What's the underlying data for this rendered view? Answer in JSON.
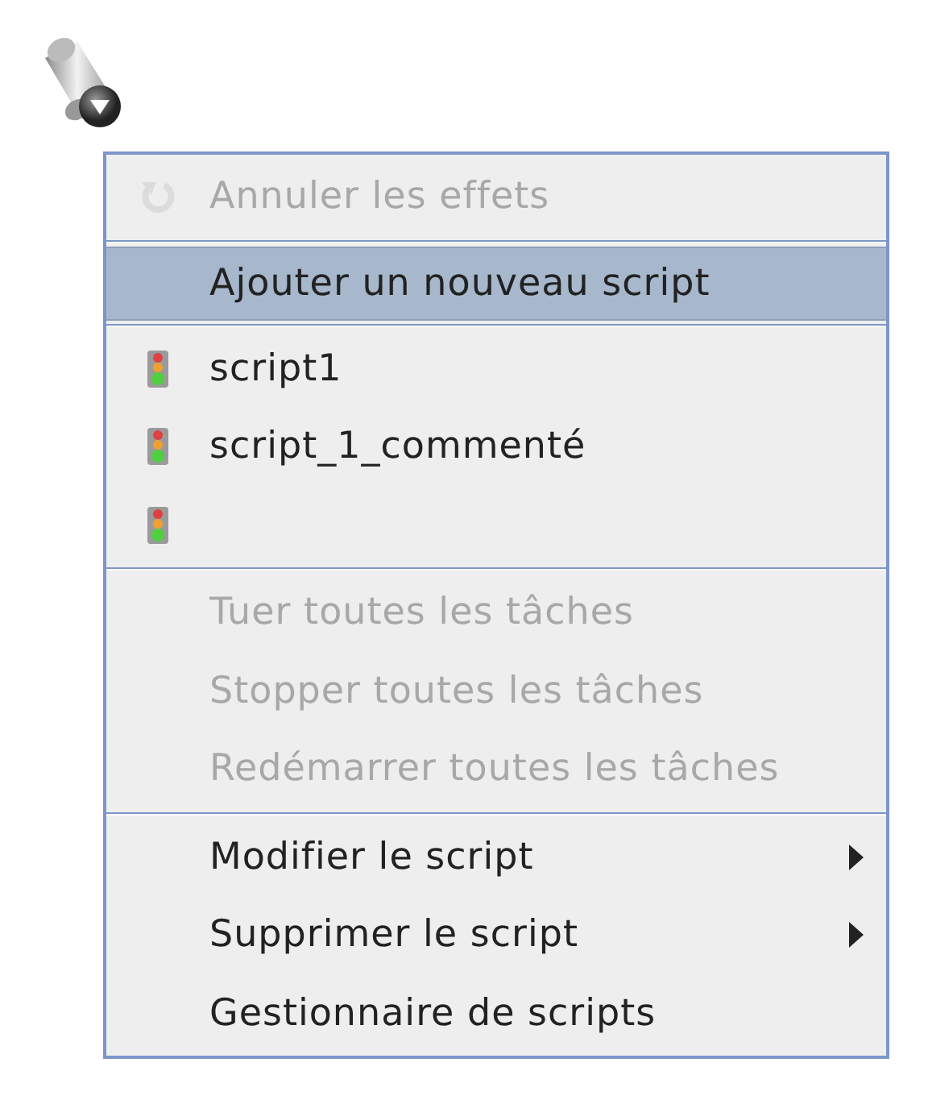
{
  "menu": {
    "sections": [
      {
        "items": [
          {
            "label": "Annuler les effets",
            "kind": "undo",
            "disabled": true,
            "selected": false,
            "submenu": false
          }
        ]
      },
      {
        "items": [
          {
            "label": "Ajouter un nouveau script",
            "kind": "plain",
            "disabled": false,
            "selected": true,
            "submenu": false
          }
        ]
      },
      {
        "items": [
          {
            "label": "script1",
            "kind": "script",
            "disabled": false,
            "selected": false,
            "submenu": false
          },
          {
            "label": "script_1_commenté",
            "kind": "script",
            "disabled": false,
            "selected": false,
            "submenu": false
          },
          {
            "kind": "script",
            "disabled": false,
            "selected": false,
            "submenu": false
          }
        ]
      },
      {
        "items": [
          {
            "label": "Tuer toutes les tâches",
            "kind": "plain",
            "disabled": true,
            "selected": false,
            "submenu": false
          },
          {
            "label": "Stopper toutes les tâches",
            "kind": "plain",
            "disabled": true,
            "selected": false,
            "submenu": false
          },
          {
            "label": "Redémarrer toutes les tâches",
            "kind": "plain",
            "disabled": true,
            "selected": false,
            "submenu": false
          }
        ]
      },
      {
        "items": [
          {
            "label": "Modifier le script",
            "kind": "plain",
            "disabled": false,
            "selected": false,
            "submenu": true
          },
          {
            "label": "Supprimer le script",
            "kind": "plain",
            "disabled": false,
            "selected": false,
            "submenu": true
          },
          {
            "label": "Gestionnaire de scripts",
            "kind": "plain",
            "disabled": false,
            "selected": false,
            "submenu": false
          }
        ]
      }
    ]
  }
}
